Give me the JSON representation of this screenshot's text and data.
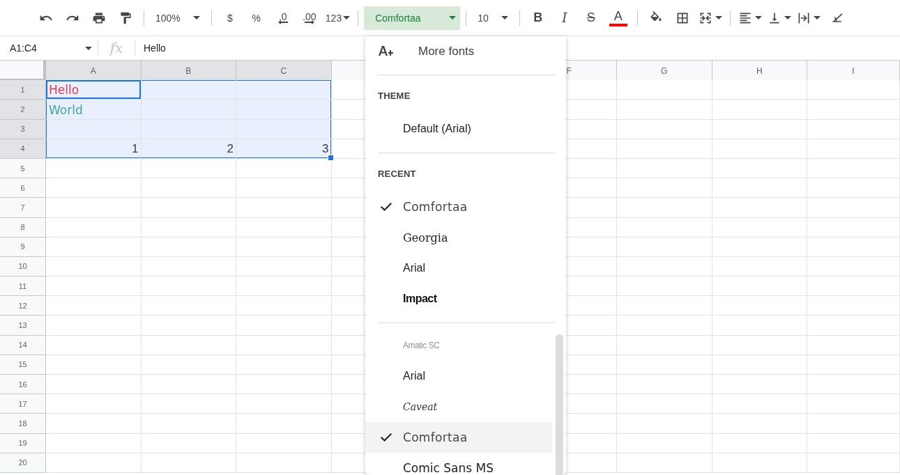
{
  "toolbar": [
    {
      "kind": "undo"
    },
    {
      "kind": "redo"
    },
    {
      "kind": "print"
    },
    {
      "kind": "paint_format"
    },
    {
      "kind": "divider"
    },
    {
      "kind": "dropdown",
      "label": "100%"
    },
    {
      "kind": "divider"
    },
    {
      "kind": "text",
      "label": "$"
    },
    {
      "kind": "text",
      "label": "%"
    },
    {
      "kind": "decimal_less",
      "label": ".0"
    },
    {
      "kind": "decimal_more",
      "label": ".00"
    },
    {
      "kind": "format_menu",
      "label": "123"
    },
    {
      "kind": "divider"
    },
    {
      "kind": "font",
      "label": "Comfortaa",
      "open": true
    },
    {
      "kind": "divider"
    },
    {
      "kind": "dropdown",
      "label": "10"
    },
    {
      "kind": "divider"
    },
    {
      "kind": "bold",
      "label": "B"
    },
    {
      "kind": "italic",
      "label": "I"
    },
    {
      "kind": "strike",
      "label": "S"
    },
    {
      "kind": "text_color",
      "label": "A"
    },
    {
      "kind": "divider"
    },
    {
      "kind": "fill"
    },
    {
      "kind": "borders"
    },
    {
      "kind": "merge"
    },
    {
      "kind": "divider"
    },
    {
      "kind": "align"
    },
    {
      "kind": "valign"
    },
    {
      "kind": "wrap"
    },
    {
      "kind": "rotate"
    }
  ],
  "formula_bar": {
    "name_box": "A1:C4",
    "fx": "fx",
    "value": "Hello"
  },
  "columns": [
    {
      "label": "A",
      "selected": true
    },
    {
      "label": "B",
      "selected": true
    },
    {
      "label": "C",
      "selected": true
    },
    {
      "kind": "covered",
      "selected": false
    },
    {
      "label": "F",
      "selected": false
    },
    {
      "label": "G",
      "selected": false
    },
    {
      "label": "H",
      "selected": false
    },
    {
      "label": "I",
      "selected": false
    }
  ],
  "rows": [
    {
      "number": "1",
      "selected": true,
      "cells": [
        {
          "text": "Hello",
          "kind": "text",
          "color": "#e8384f",
          "active": true
        }
      ]
    },
    {
      "number": "2",
      "selected": true,
      "cells": [
        {
          "text": "World",
          "kind": "text",
          "color": "#45a59a",
          "active": false
        }
      ]
    },
    {
      "number": "3",
      "selected": true
    },
    {
      "number": "4",
      "selected": true,
      "cells": [
        {
          "text": "1",
          "kind": "number",
          "active": false
        },
        {
          "text": "2",
          "kind": "number",
          "active": false
        },
        {
          "text": "3",
          "kind": "number",
          "active": false
        }
      ]
    },
    {
      "number": "5",
      "selected": false
    },
    {
      "number": "6",
      "selected": false
    },
    {
      "number": "7",
      "selected": false
    },
    {
      "number": "8",
      "selected": false
    },
    {
      "number": "9",
      "selected": false
    },
    {
      "number": "10",
      "selected": false
    },
    {
      "number": "11",
      "selected": false
    },
    {
      "number": "12",
      "selected": false
    },
    {
      "number": "13",
      "selected": false
    },
    {
      "number": "14",
      "selected": false
    },
    {
      "number": "15",
      "selected": false
    },
    {
      "number": "16",
      "selected": false
    },
    {
      "number": "17",
      "selected": false
    },
    {
      "number": "18",
      "selected": false
    },
    {
      "number": "19",
      "selected": false
    },
    {
      "number": "20",
      "selected": false
    }
  ],
  "font_menu": {
    "more_fonts": "More fonts",
    "sections": [
      {
        "heading": "THEME",
        "items": [
          {
            "label": "Default (Arial)",
            "kind": "default",
            "checked": false,
            "selected": false
          }
        ]
      },
      {
        "heading": "RECENT",
        "items": [
          {
            "label": "Comfortaa",
            "kind": "comfortaa",
            "checked": true,
            "selected": false
          },
          {
            "label": "Georgia",
            "kind": "georgia",
            "checked": false,
            "selected": false
          },
          {
            "label": "Arial",
            "kind": "arial",
            "checked": false,
            "selected": false
          },
          {
            "label": "Impact",
            "kind": "impact",
            "checked": false,
            "selected": false
          }
        ]
      },
      {
        "items": [
          {
            "label": "Amatic SC",
            "kind": "amatic",
            "checked": false,
            "selected": false
          },
          {
            "label": "Arial",
            "kind": "arial",
            "checked": false,
            "selected": false
          },
          {
            "label": "Caveat",
            "kind": "caveat",
            "checked": false,
            "selected": false
          },
          {
            "label": "Comfortaa",
            "kind": "comfortaa",
            "checked": true,
            "selected": true
          },
          {
            "label": "Comic Sans MS",
            "kind": "comic",
            "checked": false,
            "selected": false
          }
        ]
      }
    ]
  }
}
